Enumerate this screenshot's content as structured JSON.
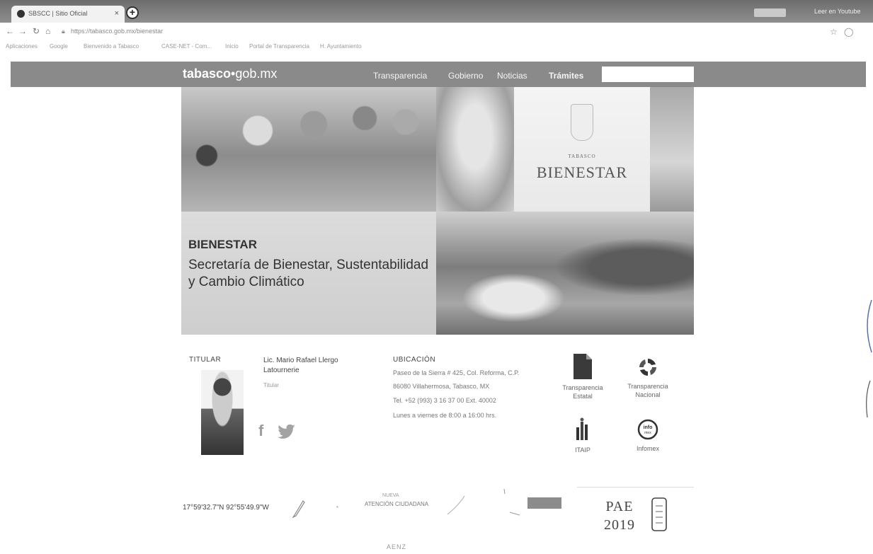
{
  "browser": {
    "tab_title": "SBSCC | Sitio Oficial",
    "tab_close": "×",
    "new_tab": "+",
    "url": "https://tabasco.gob.mx/bienestar",
    "window_text": "Leer en Youtube"
  },
  "bookmarks": [
    "Aplicaciones",
    "Google",
    "Bienvenido a Tabasco",
    "CASE-NET - Com...",
    "Inicio",
    "Portal de Transparencia",
    "H. Ayuntamiento"
  ],
  "site": {
    "logo_bold": "tabasco",
    "logo_dot": "•",
    "logo_rest": "gob.mx",
    "nav": [
      "Transparencia",
      "Gobierno",
      "Noticias",
      "Trámites"
    ]
  },
  "hero": {
    "emblem_small": "TABASCO",
    "emblem_big": "BIENESTAR",
    "kicker": "BIENESTAR",
    "title": "Secretaría de Bienestar, Sustentabilidad y Cambio Climático"
  },
  "info": {
    "titular_label": "TITULAR",
    "titular_name": "Lic. Mario Rafael Llergo Latournerie",
    "titular_role": "Titular",
    "titular_email": "",
    "ubicacion_label": "UBICACIÓN",
    "ubicacion_lines": [
      "Paseo de la Sierra # 425, Col. Reforma, C.P.",
      "86080 Villahermosa, Tabasco, MX",
      "Tel. +52 (993) 3 16 37 00 Ext. 40002",
      "Lunes a viernes de 8:00 a 16:00 hrs."
    ],
    "portals": [
      {
        "label": "Transparencia Estatal",
        "icon": "document-icon"
      },
      {
        "label": "Transparencia Nacional",
        "icon": "pnt-logo-icon"
      },
      {
        "label": "ITAIP",
        "icon": "itaip-logo-icon"
      },
      {
        "label": "Infomex",
        "icon": "infomex-logo-icon"
      }
    ]
  },
  "footer": {
    "coords": "17°59'32.7\"N 92°55'49.9\"W",
    "center_top": "NUEVA",
    "center_mid": "ATENCIÓN CIUDADANA",
    "center_bottom": "",
    "badge": "",
    "pae_line1": "PAE",
    "pae_line2": "2019",
    "bottom_text": "AENZ"
  },
  "colors": {
    "header_bg": "#8a8a8a",
    "hero_panel_bg": "#d6d6d6",
    "text_dark": "#333333"
  }
}
